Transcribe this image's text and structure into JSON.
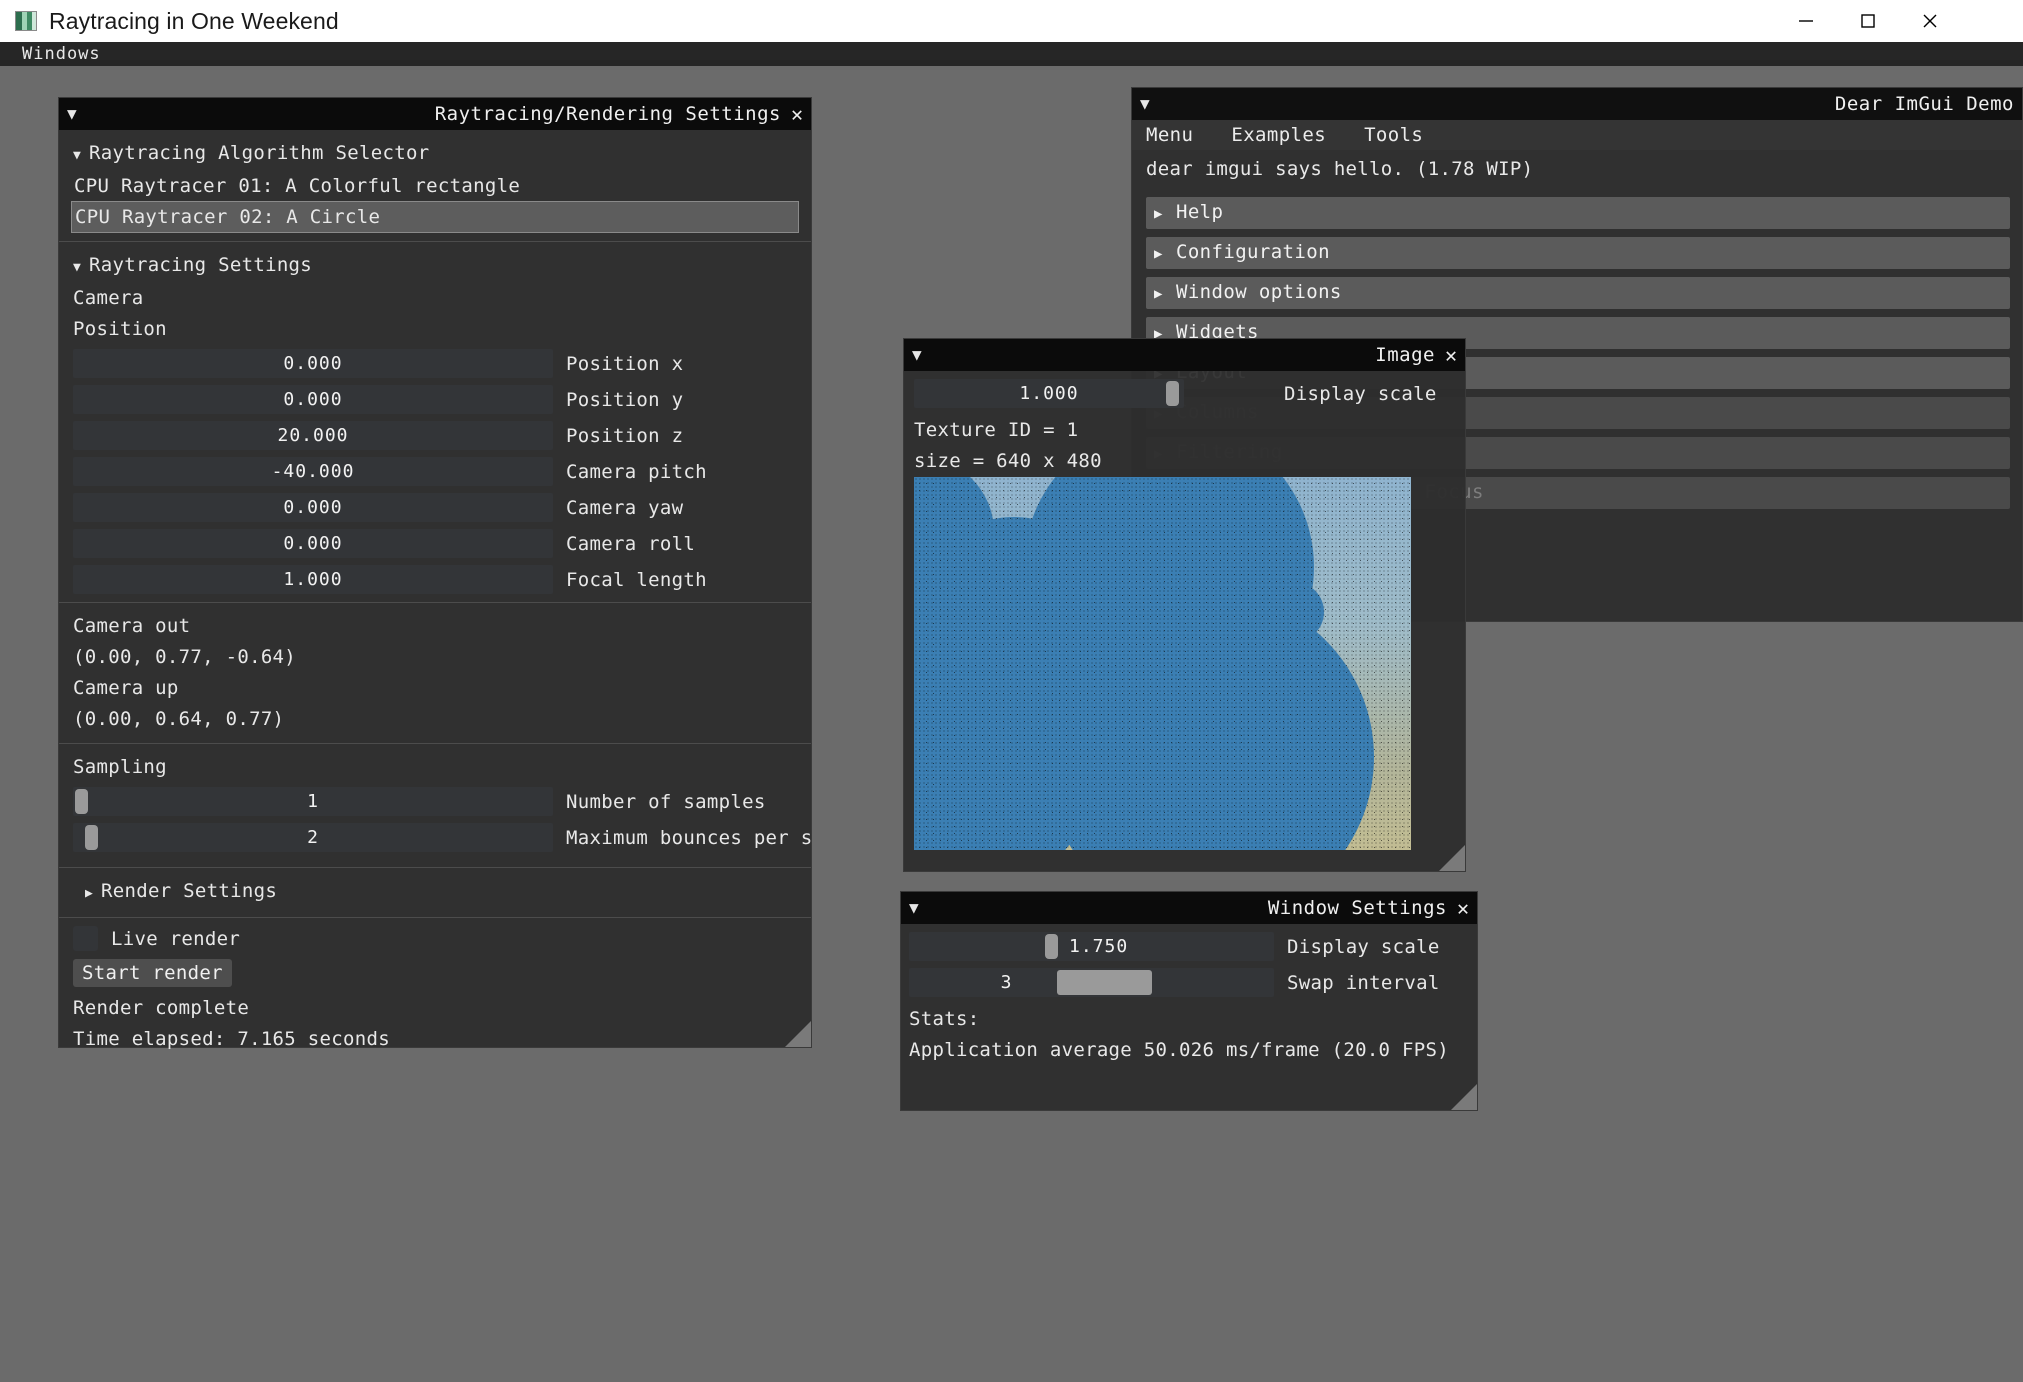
{
  "os_window": {
    "title": "Raytracing in One Weekend",
    "icon": "app-icon",
    "buttons": {
      "minimize": "—",
      "maximize": "□",
      "close": "✕"
    }
  },
  "menu_bar": {
    "items": [
      "Windows"
    ]
  },
  "settings_window": {
    "title": "Raytracing/Rendering Settings",
    "close_glyph": "✕",
    "collapse_glyph": "▼",
    "algorithm_selector": {
      "header": "Raytracing Algorithm Selector",
      "options": [
        {
          "label": "CPU Raytracer 01: A Colorful rectangle",
          "selected": false
        },
        {
          "label": "CPU Raytracer 02: A Circle",
          "selected": true
        }
      ]
    },
    "raytracing_settings": {
      "header": "Raytracing Settings",
      "camera_label": "Camera",
      "position_label": "Position",
      "sliders": [
        {
          "value": "0.000",
          "label": "Position x",
          "grab": null
        },
        {
          "value": "0.000",
          "label": "Position y",
          "grab": null
        },
        {
          "value": "20.000",
          "label": "Position z",
          "grab": null
        },
        {
          "value": "-40.000",
          "label": "Camera pitch",
          "grab": null
        },
        {
          "value": "0.000",
          "label": "Camera yaw",
          "grab": null
        },
        {
          "value": "0.000",
          "label": "Camera roll",
          "grab": null
        },
        {
          "value": "1.000",
          "label": "Focal length",
          "grab": null
        }
      ],
      "camera_out_label": "Camera out",
      "camera_out_value": "(0.00, 0.77, -0.64)",
      "camera_up_label": "Camera up",
      "camera_up_value": "(0.00, 0.64, 0.77)",
      "sampling_label": "Sampling",
      "sampling_sliders": [
        {
          "value": "1",
          "label": "Number of samples",
          "grab": 0
        },
        {
          "value": "2",
          "label": "Maximum bounces per sample",
          "grab": 1
        }
      ]
    },
    "render_settings_header": "Render Settings",
    "live_render_label": "Live render",
    "live_render_checked": false,
    "start_render_button": "Start render",
    "status_text": "Render complete",
    "time_text": "Time elapsed: 7.165 seconds"
  },
  "demo_window": {
    "title": "Dear ImGui Demo",
    "collapse_glyph": "▼",
    "menu": [
      "Menu",
      "Examples",
      "Tools"
    ],
    "greeting": "dear imgui says hello. (1.78 WIP)",
    "headers": [
      {
        "label": "Help",
        "dim": false
      },
      {
        "label": "Configuration",
        "dim": false
      },
      {
        "label": "Window options",
        "dim": false
      },
      {
        "label": "Widgets",
        "dim": false
      },
      {
        "label": "Layout",
        "dim": false
      },
      {
        "label": "Columns",
        "dim": true
      },
      {
        "label": "Filtering",
        "dim": true
      },
      {
        "label": "Inputs, Navigation & Focus",
        "dim": true
      }
    ],
    "arrow_glyph": "▶"
  },
  "image_window": {
    "title": "Image",
    "close_glyph": "✕",
    "collapse_glyph": "▼",
    "display_scale": {
      "value": "1.000",
      "label": "Display scale"
    },
    "texture_id": "Texture ID = 1",
    "size_text": "size = 640 x 480"
  },
  "window_settings": {
    "title": "Window Settings",
    "close_glyph": "✕",
    "collapse_glyph": "▼",
    "display_scale": {
      "value": "1.750",
      "label": "Display scale"
    },
    "swap_interval": {
      "value": "3",
      "label": "Swap interval"
    },
    "stats_label": "Stats:",
    "stats_value": "Application average 50.026 ms/frame (20.0 FPS)"
  },
  "colors": {
    "desktop": "#6b6b6b",
    "window_bg": "#2d2d2d",
    "title_bg": "#0b0b0b",
    "header_bg": "#5b5b5b",
    "slider_track": "#333538",
    "text": "#e8e8e8",
    "sphere": "#3b7fb4"
  }
}
